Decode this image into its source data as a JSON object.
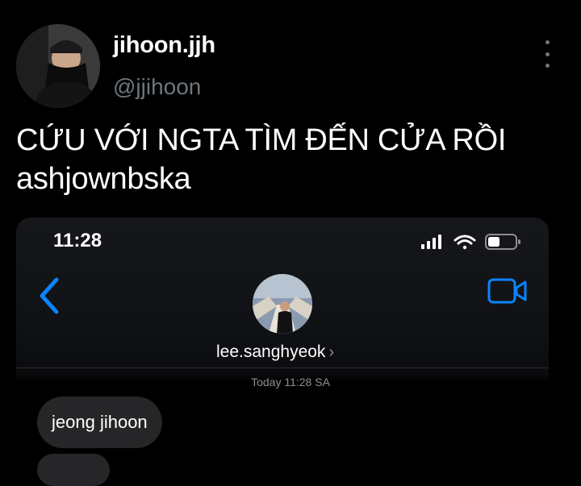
{
  "author": {
    "display_name": "jihoon.jjh",
    "handle": "@jjihoon"
  },
  "tweet": {
    "text_lines": [
      "CỨU VỚI NGTA TÌM ĐẾN CỬA RỒI",
      "ashjownbska"
    ]
  },
  "icons": {
    "more": "more-vertical-icon",
    "back": "chevron-left-icon",
    "video": "video-camera-icon",
    "signal": "cellular-signal-icon",
    "wifi": "wifi-icon",
    "battery": "battery-icon"
  },
  "screenshot": {
    "status_time": "11:28",
    "contact_name": "lee.sanghyeok",
    "contact_chevron": "›",
    "timestamp": "Today 11:28 SA",
    "messages": [
      {
        "text": "jeong jihoon"
      }
    ]
  },
  "colors": {
    "background": "#000000",
    "secondary_text": "#6e767d",
    "ios_blue": "#0a84ff",
    "bubble": "#262628"
  }
}
